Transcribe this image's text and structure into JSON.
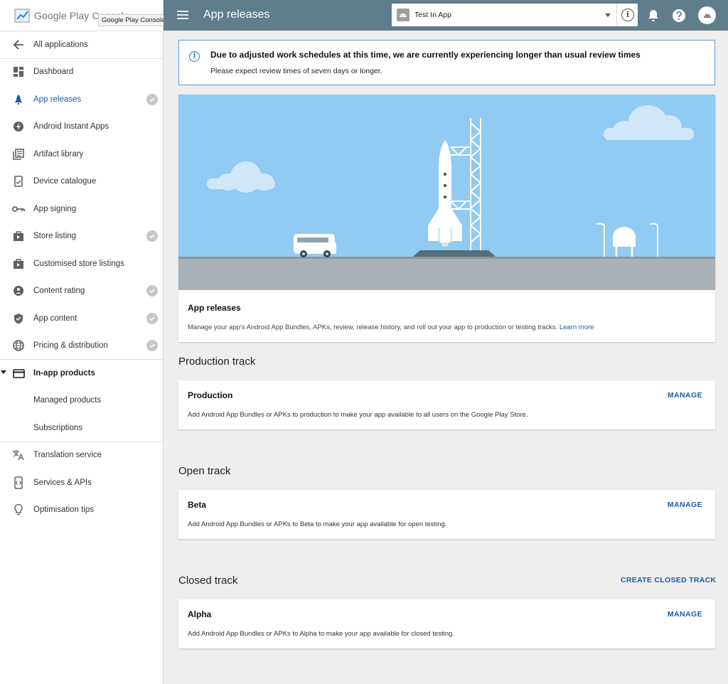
{
  "brand": {
    "logo_text": "Google Play Console",
    "tooltip": "Google Play Console"
  },
  "sidebar": {
    "back": {
      "label": "All applications",
      "icon": "arrow-back-icon"
    },
    "items": [
      {
        "label": "Dashboard",
        "icon": "dashboard-icon",
        "checked": false
      },
      {
        "label": "App releases",
        "icon": "rocket-icon",
        "checked": true,
        "active": true
      },
      {
        "label": "Android Instant Apps",
        "icon": "bolt-icon",
        "checked": false
      },
      {
        "label": "Artifact library",
        "icon": "library-icon",
        "checked": false
      },
      {
        "label": "Device catalogue",
        "icon": "devices-icon",
        "checked": false
      },
      {
        "label": "App signing",
        "icon": "key-icon",
        "checked": false
      },
      {
        "label": "Store listing",
        "icon": "store-icon",
        "checked": true
      },
      {
        "label": "Customised store listings",
        "icon": "store-custom-icon",
        "checked": false
      },
      {
        "label": "Content rating",
        "icon": "rating-icon",
        "checked": true
      },
      {
        "label": "App content",
        "icon": "shield-icon",
        "checked": true
      },
      {
        "label": "Pricing & distribution",
        "icon": "globe-icon",
        "checked": true
      }
    ],
    "inapp": {
      "label": "In-app products",
      "icon": "credit-card-icon",
      "children": [
        "Managed products",
        "Subscriptions"
      ]
    },
    "bottom_items": [
      {
        "label": "Translation service",
        "icon": "translate-icon"
      },
      {
        "label": "Services & APIs",
        "icon": "api-icon"
      },
      {
        "label": "Optimisation tips",
        "icon": "lightbulb-icon"
      }
    ]
  },
  "topbar": {
    "title": "App releases",
    "app_name": "Test In App",
    "colors": {
      "bar": "#607d8b",
      "accent": "#1a5ba6"
    }
  },
  "notice": {
    "title": "Due to adjusted work schedules at this time, we are currently experiencing longer than usual review times",
    "body": "Please expect review times of seven days or longer."
  },
  "hero": {
    "title": "App releases",
    "description": "Manage your app's Android App Bundles, APKs, review, release history, and roll out your app to production or testing tracks.",
    "link": "Learn more"
  },
  "sections": {
    "production": {
      "title": "Production track",
      "card": {
        "name": "Production",
        "description": "Add Android App Bundles or APKs to production to make your app available to all users on the Google Play Store.",
        "action": "MANAGE"
      }
    },
    "open": {
      "title": "Open track",
      "card": {
        "name": "Beta",
        "description": "Add Android App Bundles or APKs to Beta to make your app available for open testing.",
        "action": "MANAGE"
      }
    },
    "closed": {
      "title": "Closed track",
      "create_action": "CREATE CLOSED TRACK",
      "card": {
        "name": "Alpha",
        "description": "Add Android App Bundles or APKs to Alpha to make your app available for closed testing.",
        "action": "MANAGE"
      }
    }
  }
}
